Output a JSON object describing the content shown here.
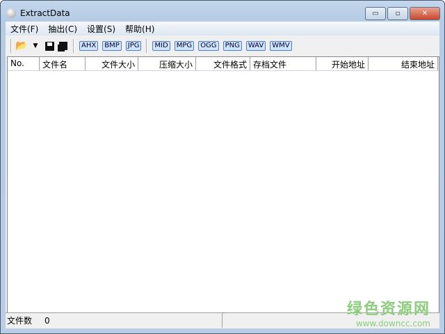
{
  "window": {
    "title": "ExtractData",
    "minimize": "▭",
    "maximize": "▫",
    "close": "✕"
  },
  "menu": [
    "文件(F)",
    "抽出(C)",
    "设置(S)",
    "帮助(H)"
  ],
  "toolbar": {
    "formats": [
      "AHX",
      "BMP",
      "JPG",
      "MID",
      "MPG",
      "OGG",
      "PNG",
      "WAV",
      "WMV"
    ]
  },
  "columns": [
    "No.",
    "文件名",
    "文件大小",
    "压缩大小",
    "文件格式",
    "存档文件",
    "开始地址",
    "结束地址"
  ],
  "status": {
    "label": "文件数",
    "count": "0"
  },
  "watermark": {
    "name": "绿色资源网",
    "url": "www.downcc.com"
  }
}
